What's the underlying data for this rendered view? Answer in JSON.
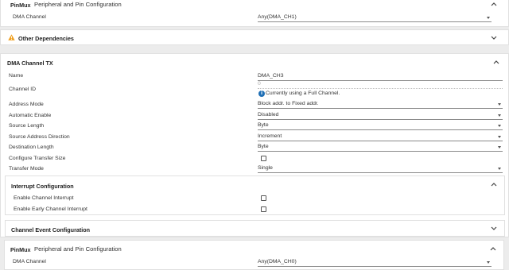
{
  "pinmux_top": {
    "title": "PinMux",
    "subtitle": "Peripheral and Pin Configuration",
    "dma_channel_label": "DMA Channel",
    "dma_channel_value": "Any(DMA_CH1)"
  },
  "other_dependencies": {
    "title": "Other Dependencies"
  },
  "dma_channel_tx": {
    "title": "DMA Channel TX",
    "fields": {
      "name_label": "Name",
      "name_value": "DMA_CH3",
      "channel_id_label": "Channel ID",
      "channel_id_value": "0",
      "channel_id_info": "Currently using a Full Channel.",
      "address_mode_label": "Address Mode",
      "address_mode_value": "Block addr. to Fixed addr.",
      "automatic_enable_label": "Automatic Enable",
      "automatic_enable_value": "Disabled",
      "source_length_label": "Source Length",
      "source_length_value": "Byte",
      "source_address_direction_label": "Source Address Direction",
      "source_address_direction_value": "Increment",
      "destination_length_label": "Destination Length",
      "destination_length_value": "Byte",
      "configure_transfer_size_label": "Configure Transfer Size",
      "configure_transfer_size_checked": false,
      "transfer_mode_label": "Transfer Mode",
      "transfer_mode_value": "Single"
    }
  },
  "interrupt_configuration": {
    "title": "Interrupt Configuration",
    "enable_channel_interrupt_label": "Enable Channel Interrupt",
    "enable_channel_interrupt_checked": false,
    "enable_early_channel_interrupt_label": "Enable Early Channel Interrupt",
    "enable_early_channel_interrupt_checked": false
  },
  "channel_event_configuration": {
    "title": "Channel Event Configuration"
  },
  "pinmux_bottom": {
    "title": "PinMux",
    "subtitle": "Peripheral and Pin Configuration",
    "dma_channel_label": "DMA Channel",
    "dma_channel_value": "Any(DMA_CH0)"
  },
  "colors": {
    "background": "#ececec",
    "card": "#ffffff",
    "info_blue": "#1f6fb5",
    "warning_orange": "#f0a020"
  },
  "icons": {
    "collapse": "chevron-up-icon",
    "expand": "chevron-down-icon",
    "info": "info-icon",
    "warning": "warning-icon",
    "dropdown": "dropdown-arrow-icon"
  }
}
